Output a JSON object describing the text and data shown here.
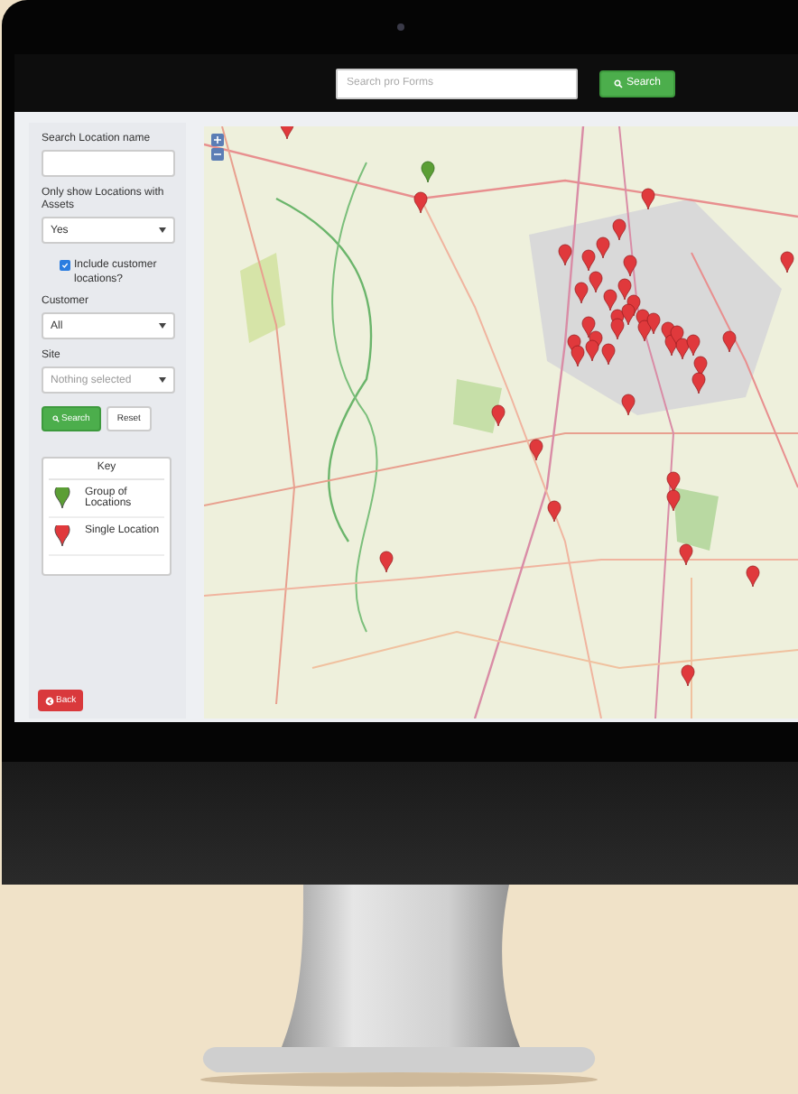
{
  "top_bar": {
    "search": {
      "placeholder": "Search pro Forms"
    },
    "search_button": "Search"
  },
  "filters": {
    "location_name": {
      "label": "Search Location name"
    },
    "assets_only": {
      "label": "Only show Locations with Assets",
      "value": "Yes"
    },
    "include_customer": {
      "label": "Include customer locations?",
      "checked": true
    },
    "customer": {
      "label": "Customer",
      "value": "All"
    },
    "site": {
      "label": "Site",
      "placeholder": "Nothing selected"
    },
    "buttons": [
      {
        "label": "Search",
        "kind": "primary"
      },
      {
        "label": "Reset",
        "kind": "default"
      }
    ]
  },
  "key": {
    "title": "Key",
    "items": [
      {
        "label": "Group of Locations",
        "color": "#5b9e35"
      },
      {
        "label": "Single Location",
        "color": "#e0393c"
      }
    ]
  },
  "back_button": "Back"
}
